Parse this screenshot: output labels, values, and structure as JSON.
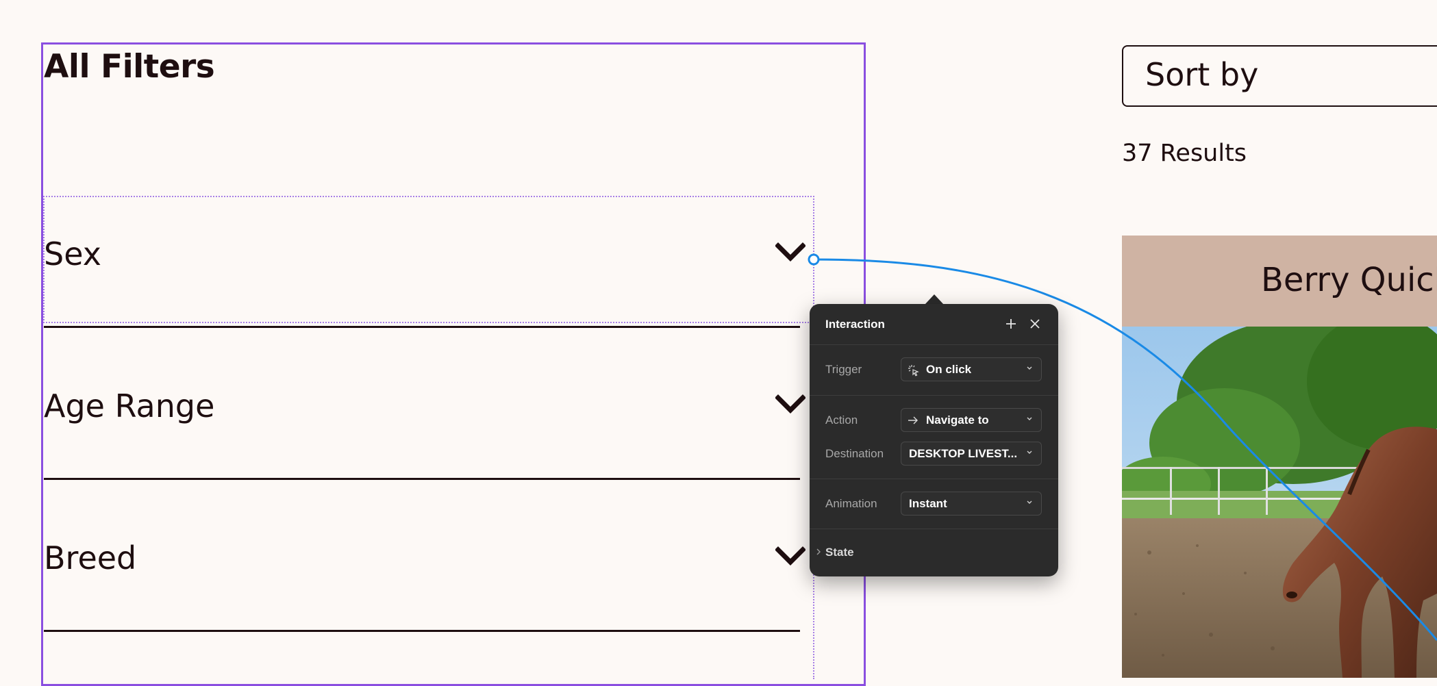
{
  "filters": {
    "title": "All Filters",
    "items": [
      {
        "label": "Sex"
      },
      {
        "label": "Age Range"
      },
      {
        "label": "Breed"
      }
    ]
  },
  "sort": {
    "label": "Sort by"
  },
  "results": {
    "count_text": "37 Results"
  },
  "card": {
    "title": "Berry Quick"
  },
  "interaction_panel": {
    "title": "Interaction",
    "trigger": {
      "label": "Trigger",
      "value": "On click"
    },
    "action": {
      "label": "Action",
      "value": "Navigate to"
    },
    "destination": {
      "label": "Destination",
      "value": "DESKTOP LIVEST..."
    },
    "animation": {
      "label": "Animation",
      "value": "Instant"
    },
    "state": {
      "label": "State"
    }
  },
  "colors": {
    "background": "#fdf9f6",
    "text": "#1e0e10",
    "selection_purple": "#8a4fe0",
    "connector_blue": "#1a8ae6",
    "panel_bg": "#2b2b2b",
    "card_header": "#cfb3a3"
  },
  "icons": [
    "chevron-down-icon",
    "plus-icon",
    "close-icon",
    "click-icon",
    "arrow-right-icon",
    "chevron-right-icon"
  ]
}
